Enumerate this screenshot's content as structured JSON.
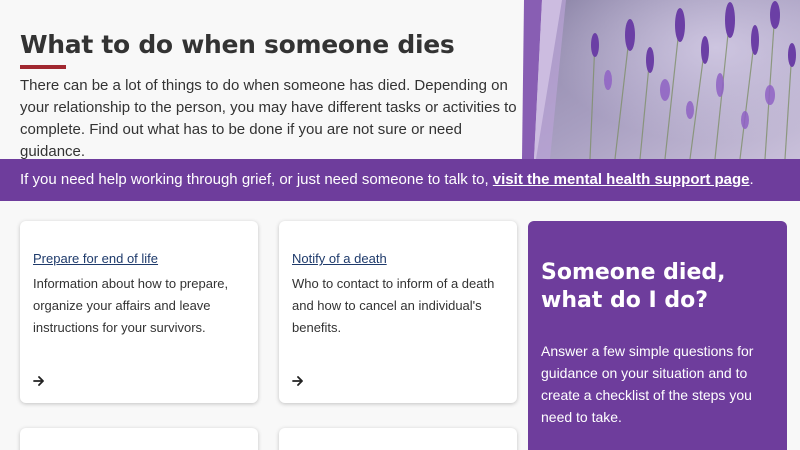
{
  "hero": {
    "title": "What to do when someone dies",
    "intro": "There can be a lot of things to do when someone has died. Depending on your relationship to the person, you may have different tasks or activities to complete. Find out what has to be done if you are not sure or need guidance.",
    "image": "lavender-flowers-photo"
  },
  "banner": {
    "text": "If you need help working through grief, or just need someone to talk to, ",
    "link_label": "visit the mental health support page",
    "suffix": "."
  },
  "cards": [
    {
      "title": "Prepare for end of life",
      "description": "Information about how to prepare, organize your affairs and leave instructions for your survivors.",
      "icon": "arrow-right-icon"
    },
    {
      "title": "Notify of a death",
      "description": "Who to contact to inform of a death and how to cancel an individual's benefits.",
      "icon": "arrow-right-icon"
    }
  ],
  "cta": {
    "title": "Someone died, what do I do?",
    "description": "Answer a few simple questions for guidance on your situation and to create a checklist of the steps you need to take."
  },
  "colors": {
    "accent_purple": "#6e3d9c",
    "title_rule": "#a12830",
    "link_blue": "#1e3a6b",
    "background": "#f8f8f8"
  }
}
